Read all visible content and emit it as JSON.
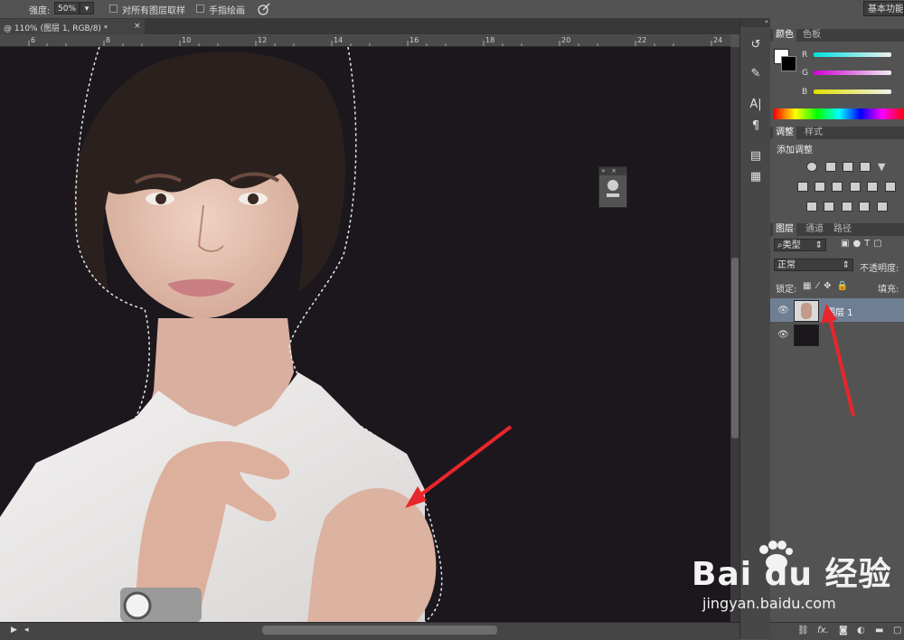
{
  "options_bar": {
    "strength_label": "强度:",
    "strength_value": "50%",
    "sample_all_layers_label": "对所有图层取样",
    "finger_painting_label": "手指绘画",
    "workspace_button": "基本功能"
  },
  "document": {
    "tab_title": "@ 110% (图层 1, RGB/8) *",
    "tab_close": "×",
    "ruler_ticks": [
      "6",
      "8",
      "10",
      "12",
      "14",
      "16",
      "18",
      "20",
      "22",
      "24"
    ]
  },
  "watermark": {
    "brand": "Bai du 经验",
    "url": "jingyan.baidu.com"
  },
  "color_panel": {
    "tabs": [
      "颜色",
      "色板"
    ],
    "channels": [
      "R",
      "G",
      "B"
    ],
    "channel_colors": [
      "#00d8d8",
      "#e030e0",
      "#e8e800"
    ]
  },
  "adjustments_panel": {
    "tabs": [
      "调整",
      "样式"
    ],
    "title": "添加调整"
  },
  "layers_panel": {
    "tabs": [
      "图层",
      "通道",
      "路径"
    ],
    "filter_kind": "类型",
    "blend_mode": "正常",
    "opacity_label": "不透明度:",
    "lock_label": "锁定:",
    "fill_label": "填充:",
    "layers": [
      {
        "name": "图层 1",
        "selected": true
      },
      {
        "name": "",
        "selected": false
      }
    ]
  },
  "colors": {
    "arrow": "#e8262b",
    "canvas_bg": "#1b171d",
    "selected_layer": "#6f7f93"
  }
}
